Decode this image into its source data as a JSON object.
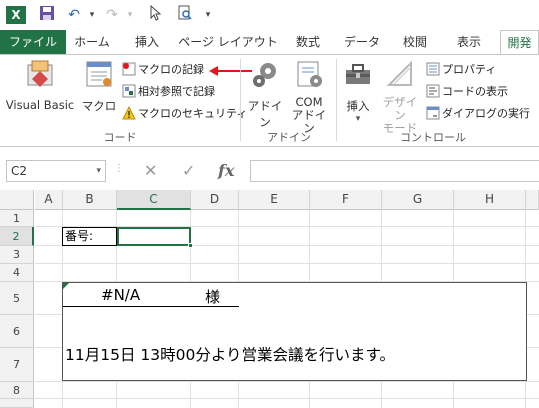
{
  "qat": {
    "logo": "X",
    "undo": "↶",
    "redo": "↷"
  },
  "tabs": {
    "file": "ファイル",
    "home": "ホーム",
    "insert": "挿入",
    "page_layout": "ページ レイアウト",
    "formulas": "数式",
    "data": "データ",
    "review": "校閲",
    "view": "表示",
    "developer": "開発"
  },
  "ribbon": {
    "code": {
      "visual_basic": "Visual Basic",
      "macro": "マクロ",
      "record_macro": "マクロの記録",
      "relative_ref": "相対参照で記録",
      "macro_security": "マクロのセキュリティ",
      "label": "コード"
    },
    "addins": {
      "addin": "アドイン",
      "com_addin_1": "COM",
      "com_addin_2": "アドイン",
      "label": "アドイン"
    },
    "controls": {
      "insert": "挿入",
      "design_mode_1": "デザイン",
      "design_mode_2": "モード",
      "properties": "プロパティ",
      "view_code": "コードの表示",
      "run_dialog": "ダイアログの実行",
      "label": "コントロール"
    }
  },
  "formula_bar": {
    "name_box": "C2",
    "fx": "fx",
    "value": ""
  },
  "sheet": {
    "columns": [
      "A",
      "B",
      "C",
      "D",
      "E",
      "F",
      "G",
      "H"
    ],
    "rows": [
      "1",
      "2",
      "3",
      "4",
      "5",
      "6",
      "7",
      "8"
    ],
    "selected_cell": "C2",
    "b2": "番号:",
    "recipient": "#N/A",
    "honorific": "様",
    "message": "11月15日  13時00分より営業会議を行います。"
  },
  "colors": {
    "accent": "#217346",
    "arrow": "#e8141b"
  }
}
